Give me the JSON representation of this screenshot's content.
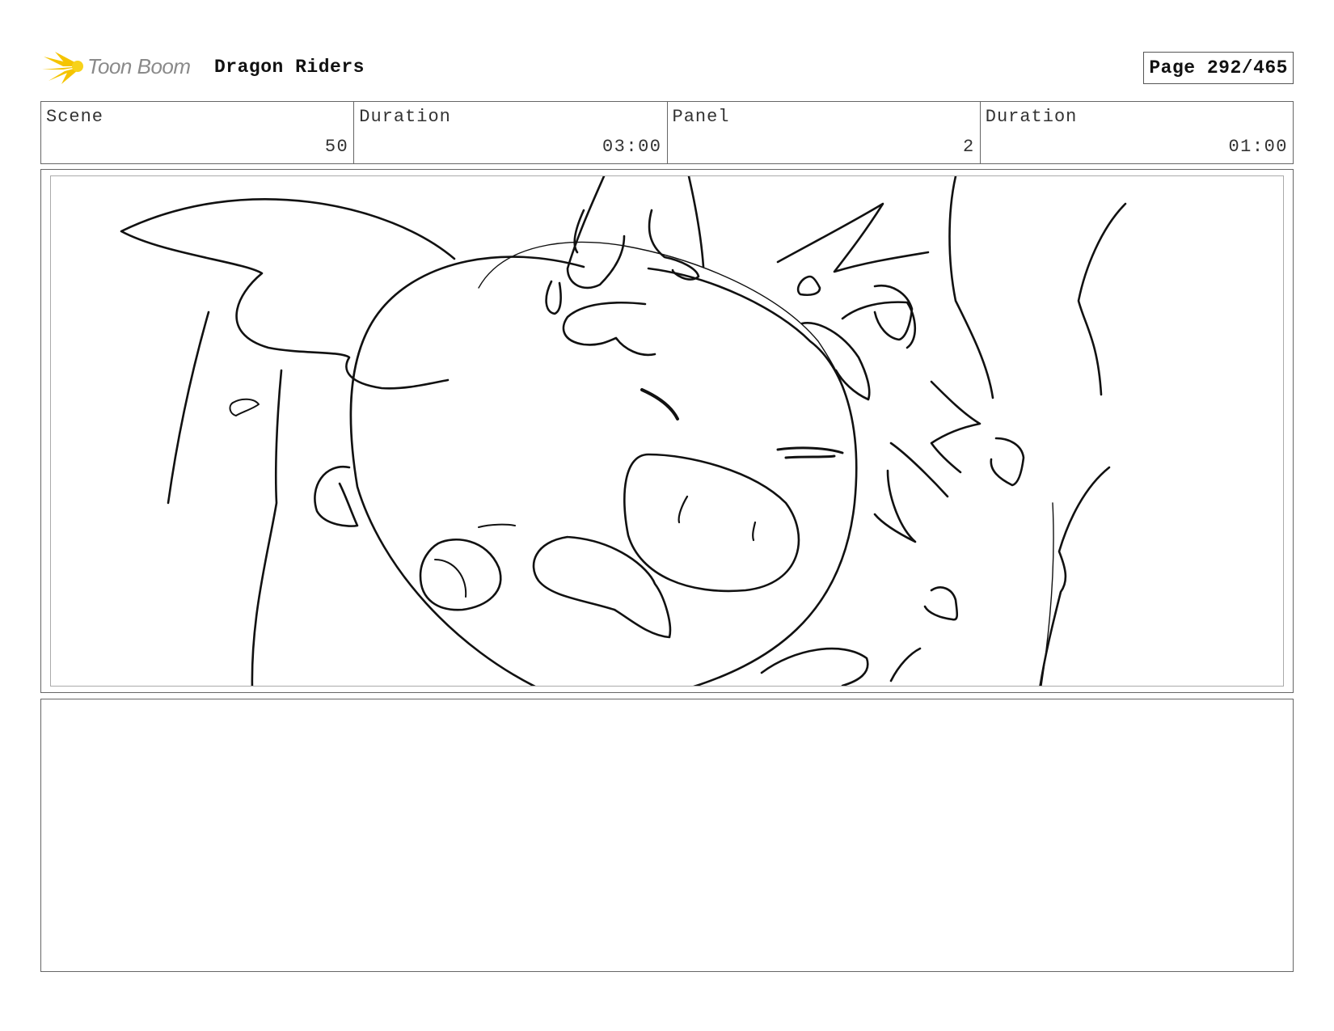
{
  "header": {
    "logo_text": "Toon Boom",
    "project_title": "Dragon Riders",
    "page_label": "Page 292/465"
  },
  "info": {
    "scene_label": "Scene",
    "scene_value": "50",
    "scene_duration_label": "Duration",
    "scene_duration_value": "03:00",
    "panel_label": "Panel",
    "panel_value": "2",
    "panel_duration_label": "Duration",
    "panel_duration_value": "01:00"
  },
  "colors": {
    "logo_accent": "#f5c400",
    "border": "#666666",
    "sketch_line": "#111111"
  },
  "notes": {
    "text": ""
  }
}
